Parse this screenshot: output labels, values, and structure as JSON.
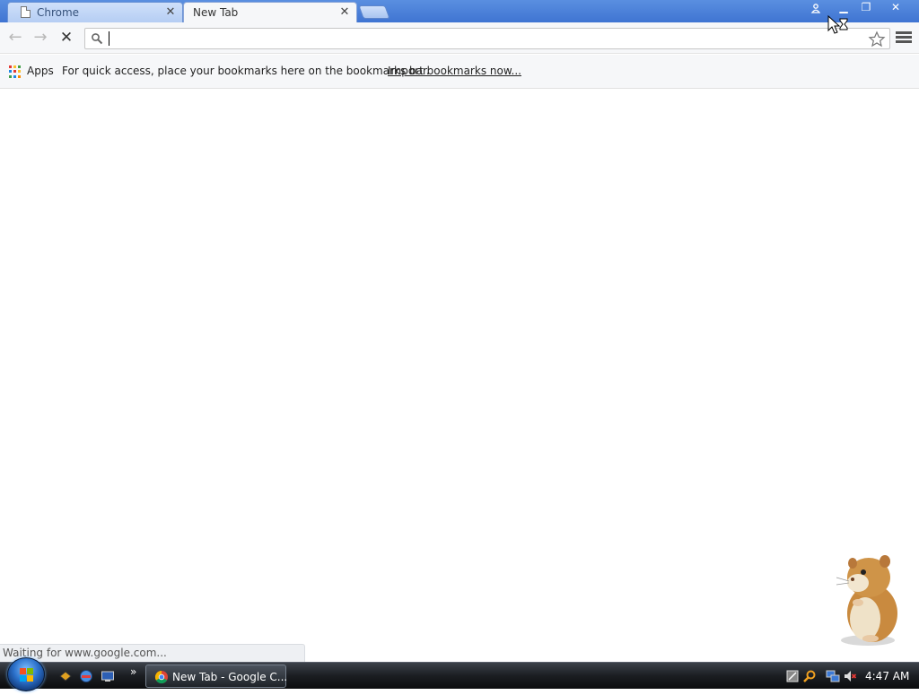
{
  "tabs": [
    {
      "title": "Chrome",
      "active": false,
      "close_glyph": "✕"
    },
    {
      "title": "New Tab",
      "active": true,
      "close_glyph": "✕"
    }
  ],
  "window_controls": {
    "profile_icon": "person-icon",
    "minimize_glyph": "▁",
    "restore_glyph": "❐",
    "close_glyph": "✕"
  },
  "toolbar": {
    "back_glyph": "←",
    "forward_glyph": "→",
    "stop_glyph": "✕",
    "omnibox_value": "",
    "omnibox_placeholder": ""
  },
  "bookmarks_bar": {
    "apps_label": "Apps",
    "hint": "For quick access, place your bookmarks here on the bookmarks bar.",
    "import_link": "Import bookmarks now...",
    "apps_colors": [
      "#e53935",
      "#fbc02d",
      "#43a047",
      "#1e88e5",
      "#e53935",
      "#fbc02d",
      "#43a047",
      "#1e88e5",
      "#fb8c00"
    ]
  },
  "status_bubble": "Waiting for www.google.com...",
  "taskbar": {
    "quick_launch_chevron": "»",
    "task_button_label": "New Tab - Google C...",
    "clock": "4:47 AM"
  },
  "colors": {
    "tabstrip": "#3f74d2",
    "toolbar": "#f6f7f9",
    "taskbar": "#1b1e22"
  }
}
